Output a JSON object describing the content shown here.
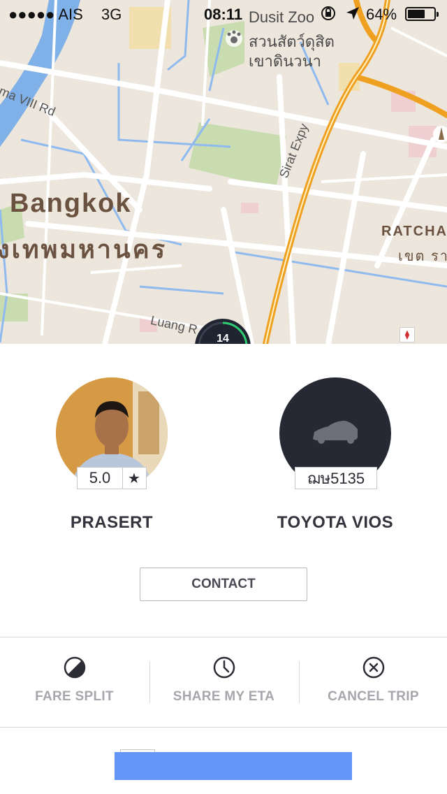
{
  "status_bar": {
    "signal": "●●●●● AIS",
    "network": "3G",
    "time": "08:11",
    "battery": "64%",
    "battery_level": 0.64
  },
  "map": {
    "city_en": "Bangkok",
    "city_th": "งเทพมหานคร",
    "poi_en": "Dusit Zoo",
    "poi_th_1": "สวนสัตว์ดุสิต",
    "poi_th_2": "เขาดินวนา",
    "road_rama": "ama VIII Rd",
    "road_expy": "Sirat Expy",
    "road_luang": "Luang R",
    "district_en": "RATCHA",
    "district_th": "เขต รา",
    "eta_minutes": "14"
  },
  "driver": {
    "name": "PRASERT",
    "rating": "5.0",
    "rating_icon": "star-icon"
  },
  "vehicle": {
    "model": "TOYOTA VIOS",
    "plate": "ฌษ5135",
    "icon": "car-icon"
  },
  "contact_label": "CONTACT",
  "actions": [
    {
      "label": "FARE SPLIT",
      "icon": "fare-split-icon"
    },
    {
      "label": "SHARE MY ETA",
      "icon": "clock-icon"
    },
    {
      "label": "CANCEL TRIP",
      "icon": "cancel-icon"
    }
  ],
  "colors": {
    "accent_blue": "#6496f7",
    "dark": "#262833",
    "expressway": "#f0a020"
  }
}
